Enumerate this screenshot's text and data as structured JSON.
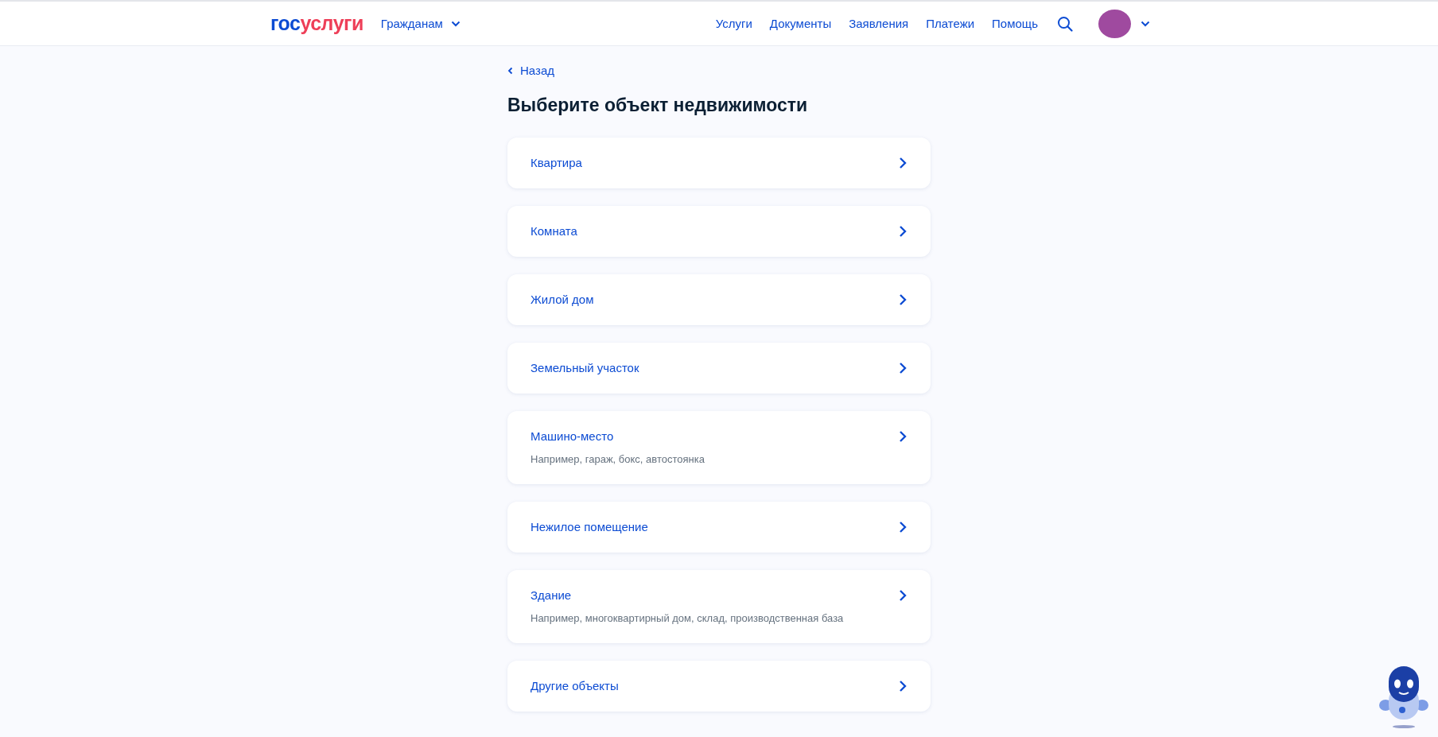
{
  "header": {
    "logo": {
      "prefix": "гос",
      "suffix": "услуги"
    },
    "audience": "Гражданам",
    "nav": [
      "Услуги",
      "Документы",
      "Заявления",
      "Платежи",
      "Помощь"
    ]
  },
  "back": "Назад",
  "title": "Выберите объект недвижимости",
  "options": [
    {
      "label": "Квартира"
    },
    {
      "label": "Комната"
    },
    {
      "label": "Жилой дом"
    },
    {
      "label": "Земельный участок"
    },
    {
      "label": "Машино-место",
      "hint": "Например, гараж, бокс, автостоянка"
    },
    {
      "label": "Нежилое помещение"
    },
    {
      "label": "Здание",
      "hint": "Например, многоквартирный дом, склад, производственная база"
    },
    {
      "label": "Другие объекты"
    }
  ]
}
